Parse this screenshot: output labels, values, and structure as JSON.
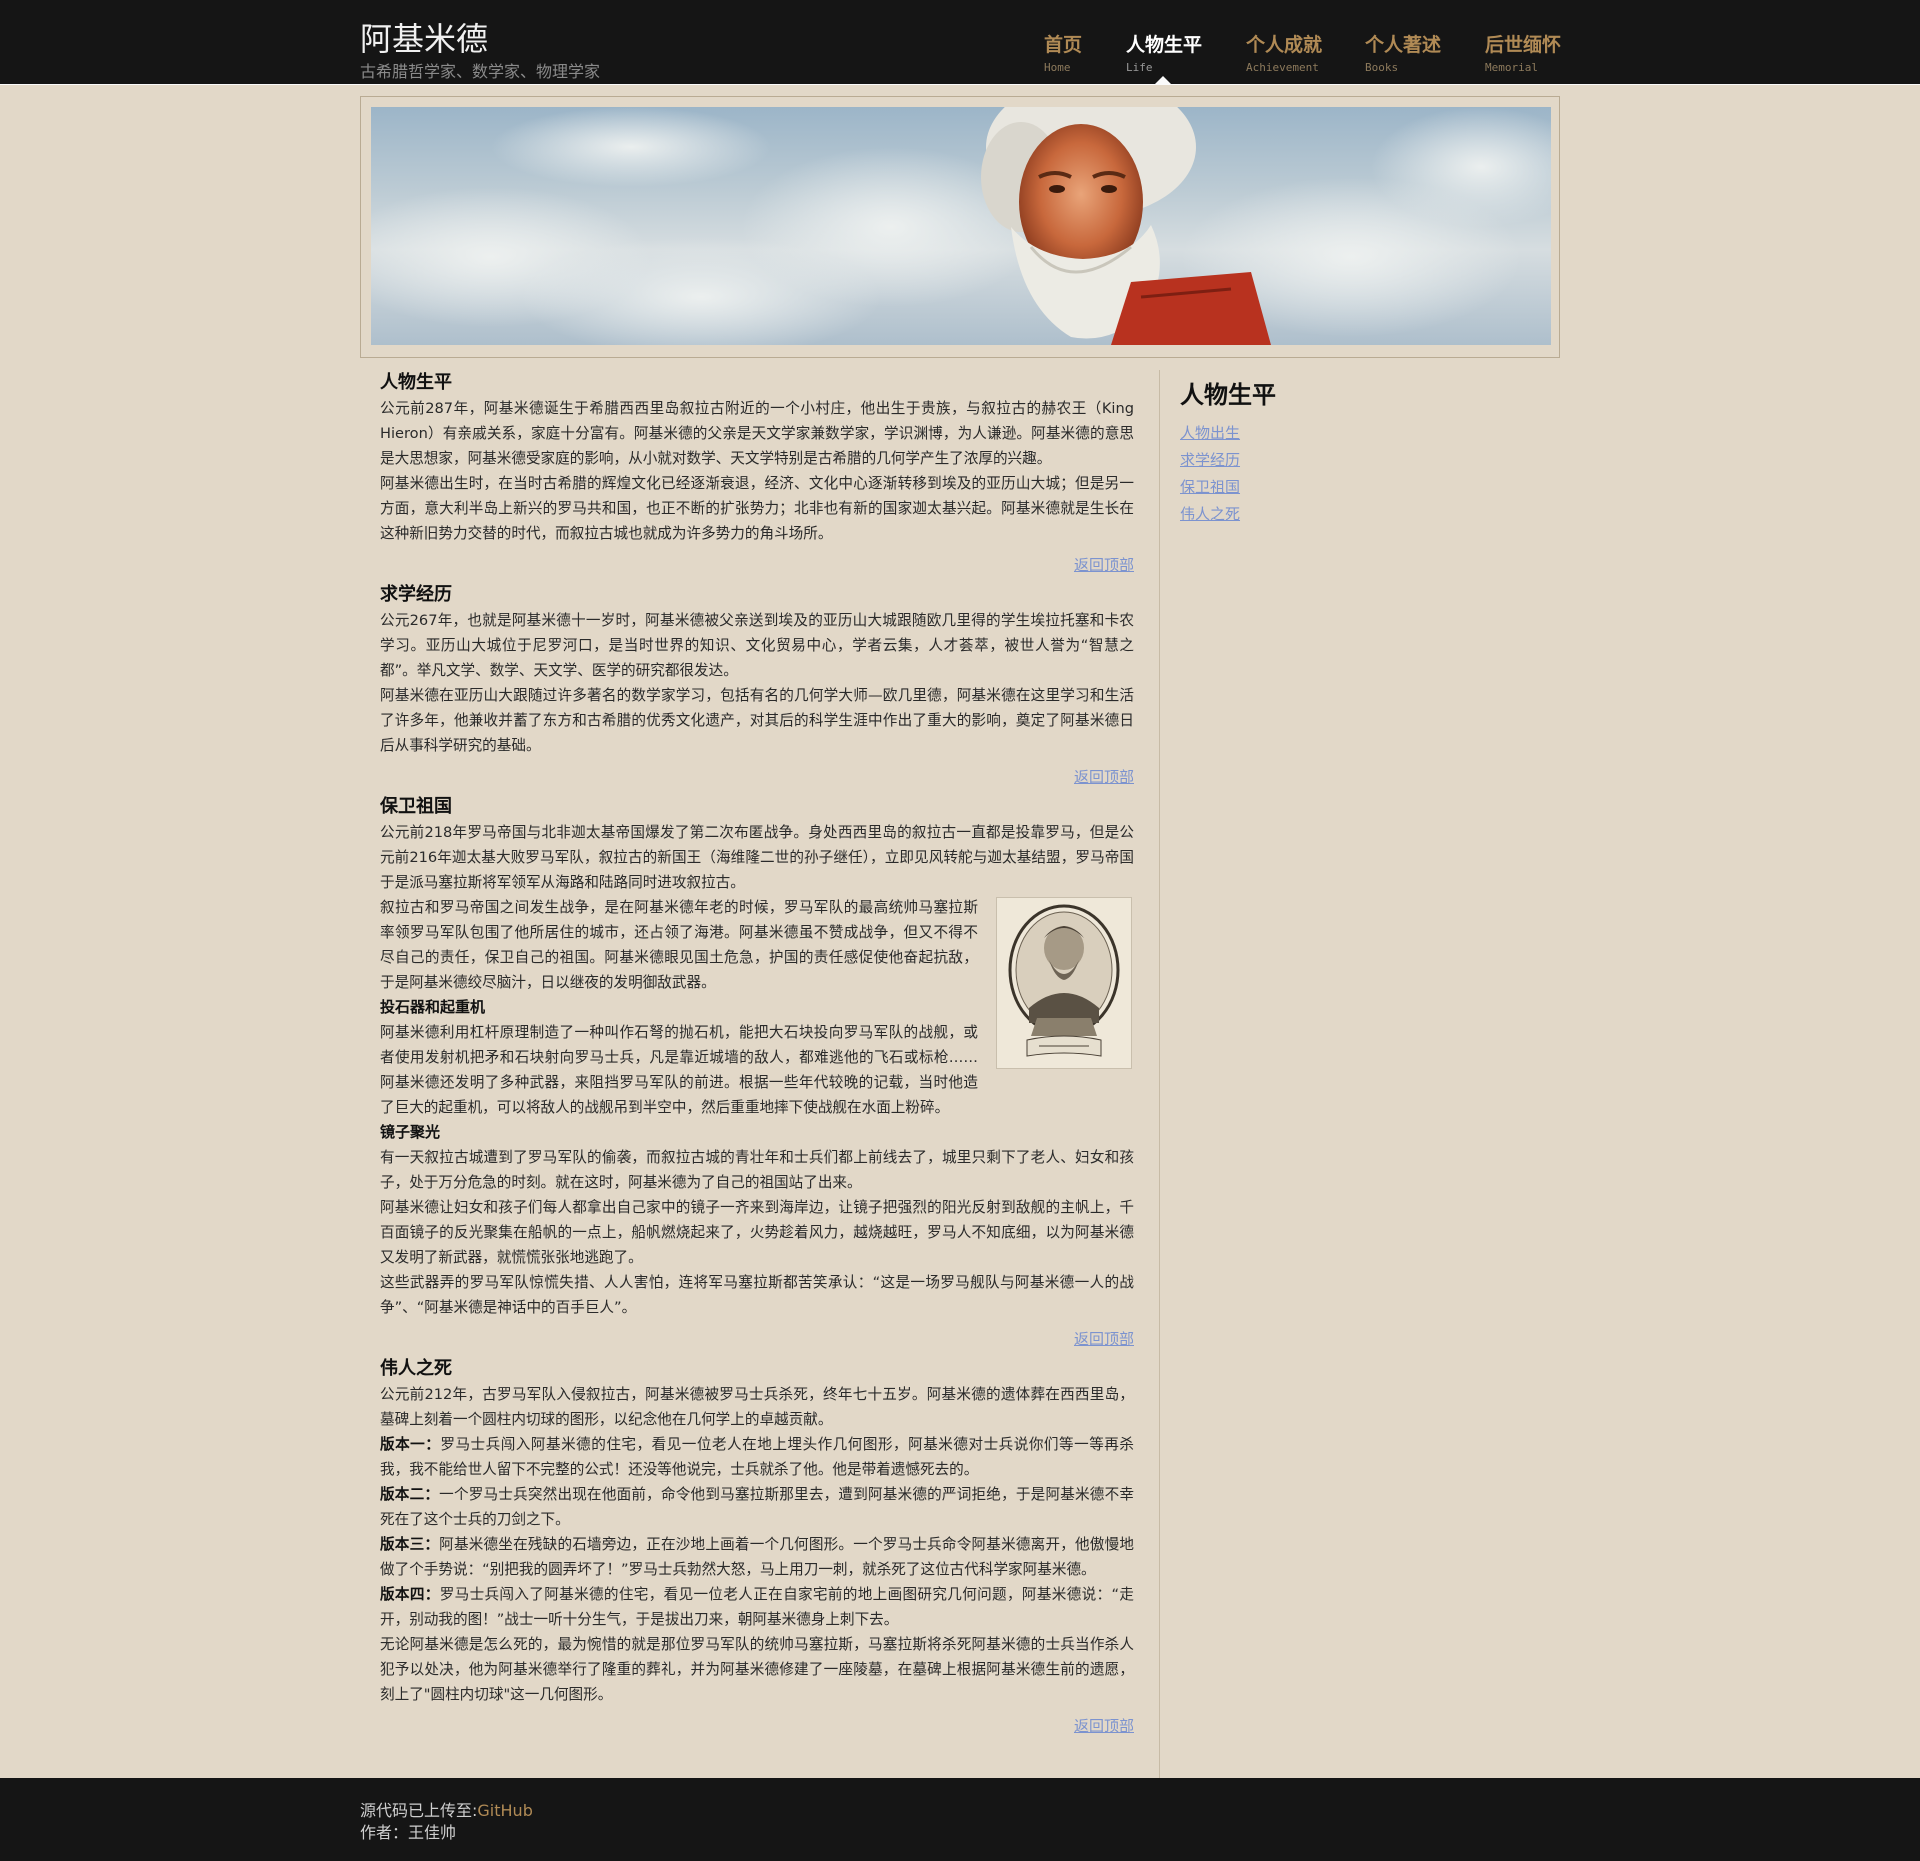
{
  "site": {
    "title": "阿基米德",
    "subtitle": "古希腊哲学家、数学家、物理学家"
  },
  "nav": [
    {
      "cn": "首页",
      "en": "Home"
    },
    {
      "cn": "人物生平",
      "en": "Life"
    },
    {
      "cn": "个人成就",
      "en": "Achievement"
    },
    {
      "cn": "个人著述",
      "en": "Books"
    },
    {
      "cn": "后世缅怀",
      "en": "Memorial"
    }
  ],
  "sections": {
    "life": {
      "title": "人物生平",
      "p1": "公元前287年，阿基米德诞生于希腊西西里岛叙拉古附近的一个小村庄，他出生于贵族，与叙拉古的赫农王（King Hieron）有亲戚关系，家庭十分富有。阿基米德的父亲是天文学家兼数学家，学识渊博，为人谦逊。阿基米德的意思是大思想家，阿基米德受家庭的影响，从小就对数学、天文学特别是古希腊的几何学产生了浓厚的兴趣。",
      "p2": "阿基米德出生时，在当时古希腊的辉煌文化已经逐渐衰退，经济、文化中心逐渐转移到埃及的亚历山大城；但是另一方面，意大利半岛上新兴的罗马共和国，也正不断的扩张势力；北非也有新的国家迦太基兴起。阿基米德就是生长在这种新旧势力交替的时代，而叙拉古城也就成为许多势力的角斗场所。"
    },
    "study": {
      "title": "求学经历",
      "p1": "公元267年，也就是阿基米德十一岁时，阿基米德被父亲送到埃及的亚历山大城跟随欧几里得的学生埃拉托塞和卡农学习。亚历山大城位于尼罗河口，是当时世界的知识、文化贸易中心，学者云集，人才荟萃，被世人誉为“智慧之都”。举凡文学、数学、天文学、医学的研究都很发达。",
      "p2": "阿基米德在亚历山大跟随过许多著名的数学家学习，包括有名的几何学大师—欧几里德，阿基米德在这里学习和生活了许多年，他兼收并蓄了东方和古希腊的优秀文化遗产，对其后的科学生涯中作出了重大的影响，奠定了阿基米德日后从事科学研究的基础。"
    },
    "defend": {
      "title": "保卫祖国",
      "p1": "公元前218年罗马帝国与北非迦太基帝国爆发了第二次布匿战争。身处西西里岛的叙拉古一直都是投靠罗马，但是公元前216年迦太基大败罗马军队，叙拉古的新国王（海维隆二世的孙子继任），立即见风转舵与迦太基结盟，罗马帝国于是派马塞拉斯将军领军从海路和陆路同时进攻叙拉古。",
      "p2": "叙拉古和罗马帝国之间发生战争，是在阿基米德年老的时候，罗马军队的最高统帅马塞拉斯率领罗马军队包围了他所居住的城市，还占领了海港。阿基米德虽不赞成战争，但又不得不尽自己的责任，保卫自己的祖国。阿基米德眼见国土危急，护国的责任感促使他奋起抗敌，于是阿基米德绞尽脑汁，日以继夜的发明御敌武器。",
      "sub1": "投石器和起重机",
      "p3": "阿基米德利用杠杆原理制造了一种叫作石弩的抛石机，能把大石块投向罗马军队的战舰，或者使用发射机把矛和石块射向罗马士兵，凡是靠近城墙的敌人，都难逃他的飞石或标枪……阿基米德还发明了多种武器，来阻挡罗马军队的前进。根据一些年代较晚的记载，当时他造了巨大的起重机，可以将敌人的战舰吊到半空中，然后重重地摔下使战舰在水面上粉碎。",
      "sub2": "镜子聚光",
      "p4": "有一天叙拉古城遭到了罗马军队的偷袭，而叙拉古城的青壮年和士兵们都上前线去了，城里只剩下了老人、妇女和孩子，处于万分危急的时刻。就在这时，阿基米德为了自己的祖国站了出来。",
      "p5": "阿基米德让妇女和孩子们每人都拿出自己家中的镜子一齐来到海岸边，让镜子把强烈的阳光反射到敌舰的主帆上，千百面镜子的反光聚集在船帆的一点上，船帆燃烧起来了，火势趁着风力，越烧越旺，罗马人不知底细，以为阿基米德又发明了新武器，就慌慌张张地逃跑了。",
      "p6": "这些武器弄的罗马军队惊慌失措、人人害怕，连将军马塞拉斯都苦笑承认：“这是一场罗马舰队与阿基米德一人的战争”、“阿基米德是神话中的百手巨人”。"
    },
    "death": {
      "title": "伟人之死",
      "p1": "公元前212年，古罗马军队入侵叙拉古，阿基米德被罗马士兵杀死，终年七十五岁。阿基米德的遗体葬在西西里岛，墓碑上刻着一个圆柱内切球的图形，以纪念他在几何学上的卓越贡献。",
      "v1_label": "版本一：",
      "v1_text": "罗马士兵闯入阿基米德的住宅，看见一位老人在地上埋头作几何图形，阿基米德对士兵说你们等一等再杀我，我不能给世人留下不完整的公式！还没等他说完，士兵就杀了他。他是带着遗憾死去的。",
      "v2_label": "版本二：",
      "v2_text": "一个罗马士兵突然出现在他面前，命令他到马塞拉斯那里去，遭到阿基米德的严词拒绝，于是阿基米德不幸死在了这个士兵的刀剑之下。",
      "v3_label": "版本三：",
      "v3_text": "阿基米德坐在残缺的石墙旁边，正在沙地上画着一个几何图形。一个罗马士兵命令阿基米德离开，他傲慢地做了个手势说：“别把我的圆弄坏了！”罗马士兵勃然大怒，马上用刀一刺，就杀死了这位古代科学家阿基米德。",
      "v4_label": "版本四：",
      "v4_text": "罗马士兵闯入了阿基米德的住宅，看见一位老人正在自家宅前的地上画图研究几何问题，阿基米德说：“走开，别动我的图！”战士一听十分生气，于是拔出刀来，朝阿基米德身上刺下去。",
      "p2": "无论阿基米德是怎么死的，最为惋惜的就是那位罗马军队的统帅马塞拉斯，马塞拉斯将杀死阿基米德的士兵当作杀人犯予以处决，他为阿基米德举行了隆重的葬礼，并为阿基米德修建了一座陵墓，在墓碑上根据阿基米德生前的遗愿，刻上了\"圆柱内切球\"这一几何图形。"
    },
    "back_to_top": "返回顶部"
  },
  "sidebar": {
    "title": "人物生平",
    "links": [
      "人物出生",
      "求学经历",
      "保卫祖国",
      "伟人之死"
    ]
  },
  "footer": {
    "source_label": "源代码已上传至:",
    "source_link": "GitHub",
    "author": "作者：王佳帅"
  },
  "colors": {
    "header_bg": "#151515",
    "page_bg": "#e2d8c8",
    "nav_accent": "#b08a55",
    "link": "#7c93cf"
  }
}
